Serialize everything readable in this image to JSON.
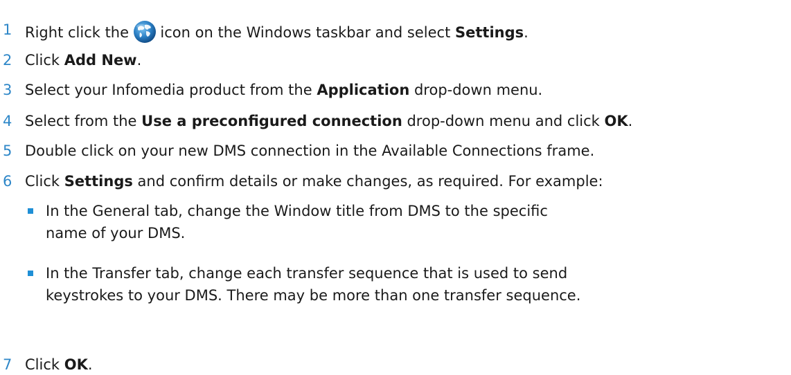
{
  "steps": [
    {
      "num": "1",
      "pre": "Right click the",
      "post": "icon on the Windows taskbar and select",
      "bold": "Settings",
      "end": ".",
      "icon": "globe-icon"
    },
    {
      "num": "2",
      "pre": "Click",
      "bold": "Add New",
      "end": "."
    },
    {
      "num": "3",
      "pre": "Select your Infomedia product from the",
      "bold": "Application",
      "post": "drop-down menu."
    },
    {
      "num": "4",
      "pre": "Select from the",
      "bold": "Use a preconfigured connection",
      "mid": "drop-down menu and click",
      "bold2": "OK",
      "end": "."
    },
    {
      "num": "5",
      "text": "Double click on your new DMS connection in the Available Connections frame."
    },
    {
      "num": "6",
      "pre": "Click",
      "bold": "Settings",
      "post": "and confirm details or make changes, as required. For example:"
    },
    {
      "num": "7",
      "pre": "Click",
      "bold": "OK",
      "end": "."
    }
  ],
  "bullets": [
    {
      "line1": "In the General tab, change the Window title from DMS to the specific",
      "line2": "name of your DMS."
    },
    {
      "line1": "In the Transfer tab, change each transfer sequence that is used to send",
      "line2": "keystrokes to your DMS. There may be more than one transfer sequence."
    }
  ],
  "colors": {
    "number": "#2e87c8",
    "bullet": "#1f8fd6",
    "text": "#1a1a1a"
  }
}
